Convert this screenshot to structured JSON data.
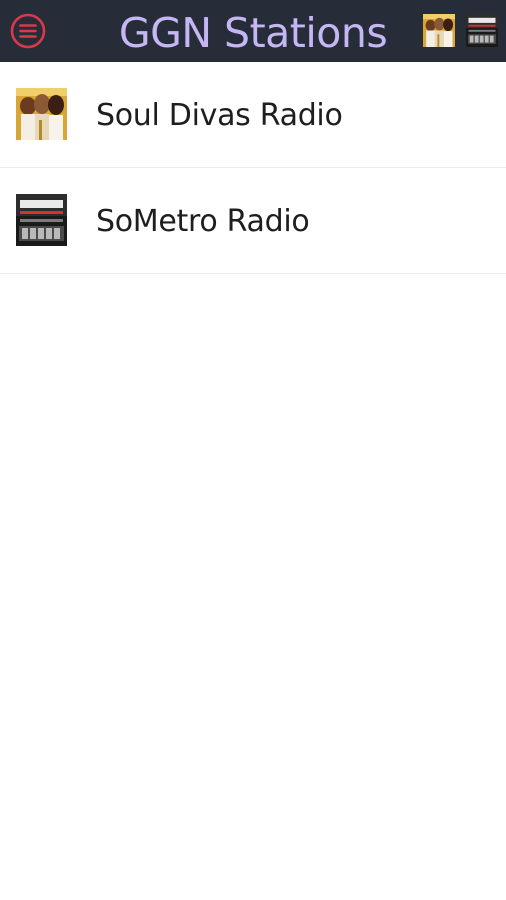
{
  "app_bar": {
    "title": "GGN Stations",
    "menu_icon": "hamburger-menu-icon",
    "accent_color": "#d93a4a",
    "background_color": "#262d38",
    "title_color": "#c5b6f4"
  },
  "stations": [
    {
      "name": "Soul Divas Radio",
      "thumbnail": "soul-divas-thumbnail"
    },
    {
      "name": "SoMetro Radio",
      "thumbnail": "sometro-thumbnail"
    }
  ]
}
